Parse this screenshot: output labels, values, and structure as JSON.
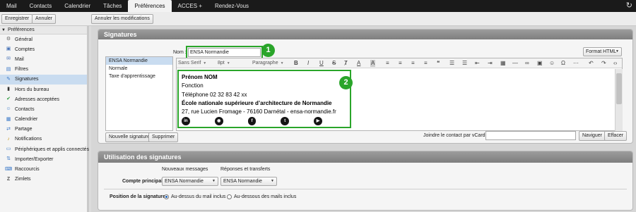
{
  "topnav": {
    "tabs": [
      "Mail",
      "Contacts",
      "Calendrier",
      "Tâches",
      "Préférences",
      "ACCES +",
      "Rendez-Vous"
    ],
    "active_index": 4
  },
  "toolbar": {
    "save_label": "Enregistrer",
    "cancel_label": "Annuler",
    "cancel_changes_label": "Annuler les modifications"
  },
  "sidebar": {
    "header": "Préférences",
    "items": [
      {
        "label": "Général",
        "icon": "gear-icon"
      },
      {
        "label": "Comptes",
        "icon": "accounts-icon"
      },
      {
        "label": "Mail",
        "icon": "mail-icon"
      },
      {
        "label": "Filtres",
        "icon": "filter-icon"
      },
      {
        "label": "Signatures",
        "icon": "signature-icon"
      },
      {
        "label": "Hors du bureau",
        "icon": "out-of-office-icon"
      },
      {
        "label": "Adresses acceptées",
        "icon": "shield-check-icon"
      },
      {
        "label": "Contacts",
        "icon": "contacts-icon"
      },
      {
        "label": "Calendrier",
        "icon": "calendar-icon"
      },
      {
        "label": "Partage",
        "icon": "share-icon"
      },
      {
        "label": "Notifications",
        "icon": "bell-icon"
      },
      {
        "label": "Périphériques et applis connectés",
        "icon": "devices-icon"
      },
      {
        "label": "Importer/Exporter",
        "icon": "import-export-icon"
      },
      {
        "label": "Raccourcis",
        "icon": "keyboard-icon"
      },
      {
        "label": "Zimlets",
        "icon": "zimlet-icon"
      }
    ],
    "selected_index": 4
  },
  "signatures": {
    "title": "Signatures",
    "name_label": "Nom :",
    "name_value": "ENSA Normandie",
    "format_label": "Format HTML",
    "list": [
      "ENSA Normandie",
      "Normale",
      "Taxe d'apprentissage"
    ],
    "selected_index": 0,
    "new_button": "Nouvelle signature",
    "delete_button": "Supprimer",
    "font_family": "Sans Serif",
    "font_size": "8pt",
    "paragraph": "Paragraphe",
    "vcard_label": "Joindre le contact par vCard :",
    "vcard_value": "",
    "browse_button": "Naviguer",
    "clear_button": "Effacer",
    "body": [
      {
        "text": "Prénom NOM",
        "bold": true
      },
      {
        "text": "Fonction",
        "bold": false
      },
      {
        "text": "Téléphone 02 32 83 42 xx",
        "bold": false
      },
      {
        "text": "École nationale supérieure d’architecture de Normandie",
        "bold": true
      },
      {
        "text": "27, rue Lucien Fromage - 76160 Darnétal - ensa-normandie.fr",
        "bold": false
      }
    ],
    "social": [
      {
        "label": "in",
        "icon": "linkedin-icon"
      },
      {
        "label": "◉",
        "icon": "instagram-icon"
      },
      {
        "label": "f",
        "icon": "facebook-icon"
      },
      {
        "label": "t",
        "icon": "twitter-icon"
      },
      {
        "label": "▶",
        "icon": "youtube-icon"
      }
    ],
    "badge1": "1",
    "badge2": "2",
    "highlight_color": "#2aa52a"
  },
  "usage": {
    "title": "Utilisation des signatures",
    "col_new": "Nouveaux messages",
    "col_replies": "Réponses et transferts",
    "account_label": "Compte principal:",
    "new_value": "ENSA Normandie",
    "reply_value": "ENSA Normandie",
    "position_label": "Position de la signature :",
    "position_above": "Au-dessus du mail inclus",
    "position_below": "Au-dessous des mails inclus",
    "position_selected": "above"
  }
}
